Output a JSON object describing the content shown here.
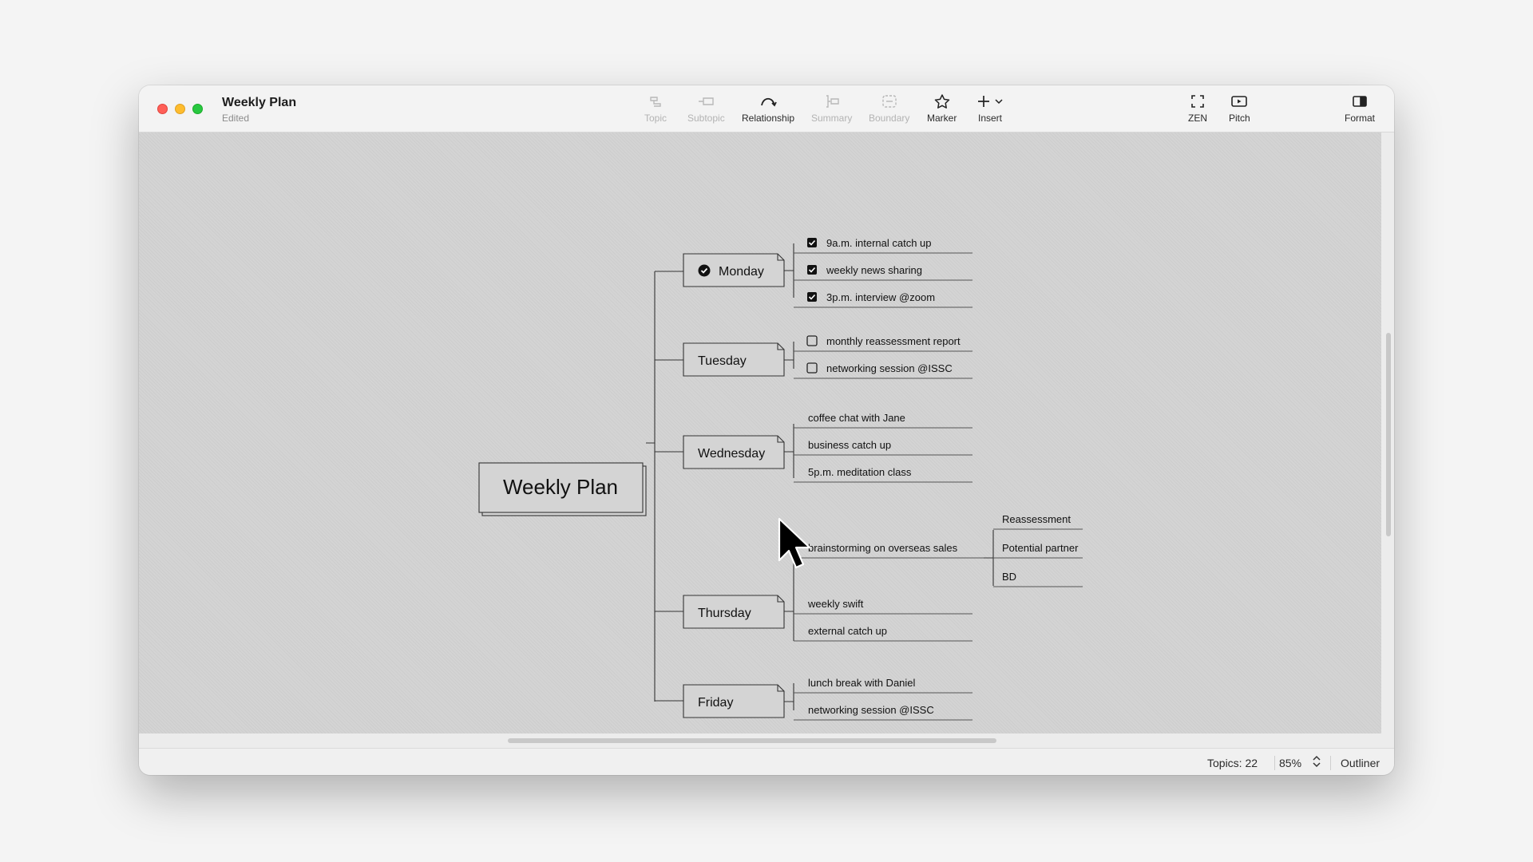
{
  "window": {
    "title": "Weekly Plan",
    "subtitle": "Edited"
  },
  "toolbar": {
    "topic": "Topic",
    "subtopic": "Subtopic",
    "relationship": "Relationship",
    "summary": "Summary",
    "boundary": "Boundary",
    "marker": "Marker",
    "insert": "Insert",
    "zen": "ZEN",
    "pitch": "Pitch",
    "format": "Format"
  },
  "map": {
    "root": "Weekly Plan",
    "days": [
      {
        "label": "Monday",
        "done": true,
        "items": [
          {
            "text": "9a.m. internal catch up",
            "checkbox": "checked"
          },
          {
            "text": "weekly news sharing",
            "checkbox": "checked"
          },
          {
            "text": "3p.m. interview @zoom",
            "checkbox": "checked"
          }
        ]
      },
      {
        "label": "Tuesday",
        "items": [
          {
            "text": "monthly reassessment report",
            "checkbox": "unchecked"
          },
          {
            "text": "networking session @ISSC",
            "checkbox": "unchecked"
          }
        ]
      },
      {
        "label": "Wednesday",
        "items": [
          {
            "text": "coffee chat with Jane"
          },
          {
            "text": "business catch up"
          },
          {
            "text": "5p.m. meditation class"
          }
        ]
      },
      {
        "label": "Thursday",
        "items": [
          {
            "text": "brainstorming on overseas sales",
            "children": [
              {
                "text": "Reassessment"
              },
              {
                "text": "Potential partner"
              },
              {
                "text": "BD"
              }
            ]
          },
          {
            "text": "weekly swift"
          },
          {
            "text": "external catch up"
          }
        ]
      },
      {
        "label": "Friday",
        "items": [
          {
            "text": "lunch break with Daniel"
          },
          {
            "text": "networking session @ISSC"
          }
        ]
      }
    ]
  },
  "status": {
    "topics": "Topics: 22",
    "zoom": "85%",
    "outliner": "Outliner"
  }
}
